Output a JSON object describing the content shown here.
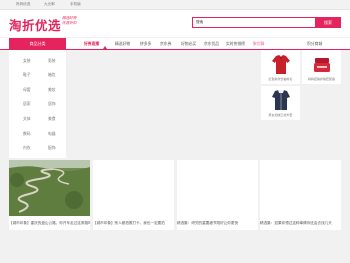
{
  "topbar": {
    "links": [
      "妈妈优选",
      "九元邮",
      "手机版"
    ]
  },
  "header": {
    "logo_text": "淘折优选",
    "slogan_line1": "精选好物",
    "slogan_line2": "优惠折扣"
  },
  "search": {
    "value": "搜索",
    "button_label": "搜索"
  },
  "nav": {
    "all_label": "商品分类",
    "items": [
      "好券直播",
      "精选好物",
      "拼多多",
      "京东券",
      "好物必买",
      "京东优品",
      "实时热销榜",
      "聚划算"
    ],
    "right_link": "积分商城"
  },
  "categories": [
    [
      "女装",
      "男装"
    ],
    [
      "鞋子",
      "箱包"
    ],
    [
      "母婴",
      "美妆"
    ],
    [
      "居家",
      "居饰"
    ],
    [
      "文体",
      "美食"
    ],
    [
      "数码",
      "电器"
    ],
    [
      "内衣",
      "配饰"
    ]
  ],
  "right_products": [
    {
      "caption": "红色新款长袖衬衫",
      "icon": "red-shirt-icon"
    },
    {
      "caption": "妈妈控肤护肤套装霜",
      "icon": "skincare-jar-icon"
    },
    {
      "caption": "男女加绒卫衣外套",
      "icon": "jacket-icon"
    }
  ],
  "cards": [
    "【城市印象】重庆的盘山公路，你开车走过这条路吗",
    "【城市印象】别人都拍照打卡，我也一定要拍",
    "精选集：研究的重要细节刚好让你更快",
    "精选集：如果你想过这种事情你还会去找几天"
  ],
  "colors": {
    "accent": "#e5245d",
    "background": "#f1f1f1"
  }
}
